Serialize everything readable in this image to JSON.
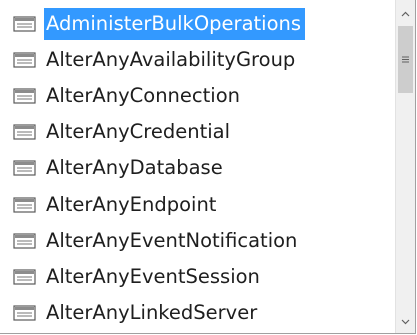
{
  "items": [
    {
      "label": "AdministerBulkOperations",
      "selected": true
    },
    {
      "label": "AlterAnyAvailabilityGroup",
      "selected": false
    },
    {
      "label": "AlterAnyConnection",
      "selected": false
    },
    {
      "label": "AlterAnyCredential",
      "selected": false
    },
    {
      "label": "AlterAnyDatabase",
      "selected": false
    },
    {
      "label": "AlterAnyEndpoint",
      "selected": false
    },
    {
      "label": "AlterAnyEventNotification",
      "selected": false
    },
    {
      "label": "AlterAnyEventSession",
      "selected": false
    },
    {
      "label": "AlterAnyLinkedServer",
      "selected": false
    }
  ],
  "icons": {
    "item_icon": "enum-value-icon",
    "scroll_up": "chevron-up-icon",
    "scroll_down": "chevron-down-icon",
    "thumb_grip": "grip-lines-icon",
    "error_mark": "error-squiggle-icon"
  },
  "colors": {
    "selection": "#3399ff",
    "error_squiggle": "#e51400"
  }
}
